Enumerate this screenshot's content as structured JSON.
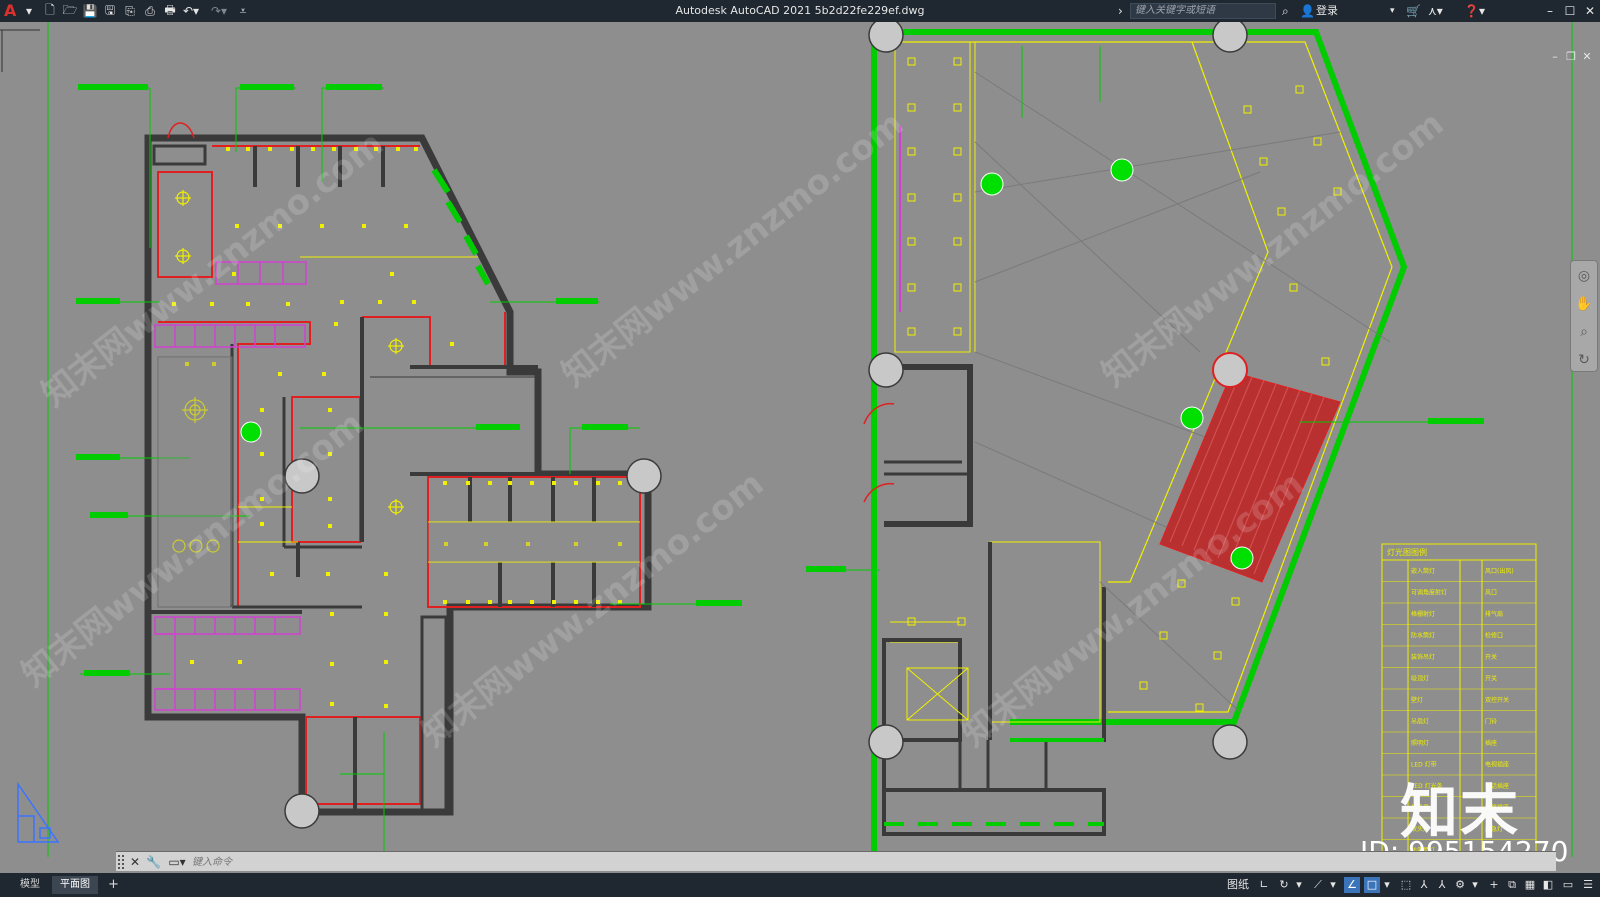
{
  "app": {
    "logo": "A",
    "title": "Autodesk AutoCAD 2021    5b2d22fe229ef.dwg",
    "search_placeholder": "键入关键字或短语",
    "login": "登录"
  },
  "command": {
    "placeholder": "键入命令"
  },
  "layout_tabs": [
    "模型",
    "平面图"
  ],
  "status": {
    "paper_label": "图纸"
  },
  "watermark": {
    "site_text": "知末网www.znzmo.com",
    "logo_text": "知末",
    "id_text": "ID: 995154270"
  },
  "legend": {
    "title": "灯光图图例",
    "left_items": [
      "嵌入筒灯",
      "可调角度射灯",
      "格栅射灯",
      "防水筒灯",
      "装饰吊灯",
      "吸顶灯",
      "壁灯",
      "吊扇灯",
      "照明灯",
      "LED 灯带",
      "LED 灯光条",
      "排风扇",
      "双头灯",
      "防雾筒灯"
    ],
    "right_items": [
      "风口(出风)",
      "风口",
      "排气扇",
      "检修口",
      "开关",
      "开关",
      "双控开关",
      "门铃",
      "插座",
      "电视插座",
      "电话插座",
      "网络插座",
      "应急灯"
    ]
  },
  "colors": {
    "background": "#8e8e8e",
    "wall": "#3a3a3a",
    "yellow": "#f0f000",
    "green": "#00e000",
    "red": "#e02020",
    "magenta": "#d040d0",
    "titlebar": "#1f2730"
  }
}
